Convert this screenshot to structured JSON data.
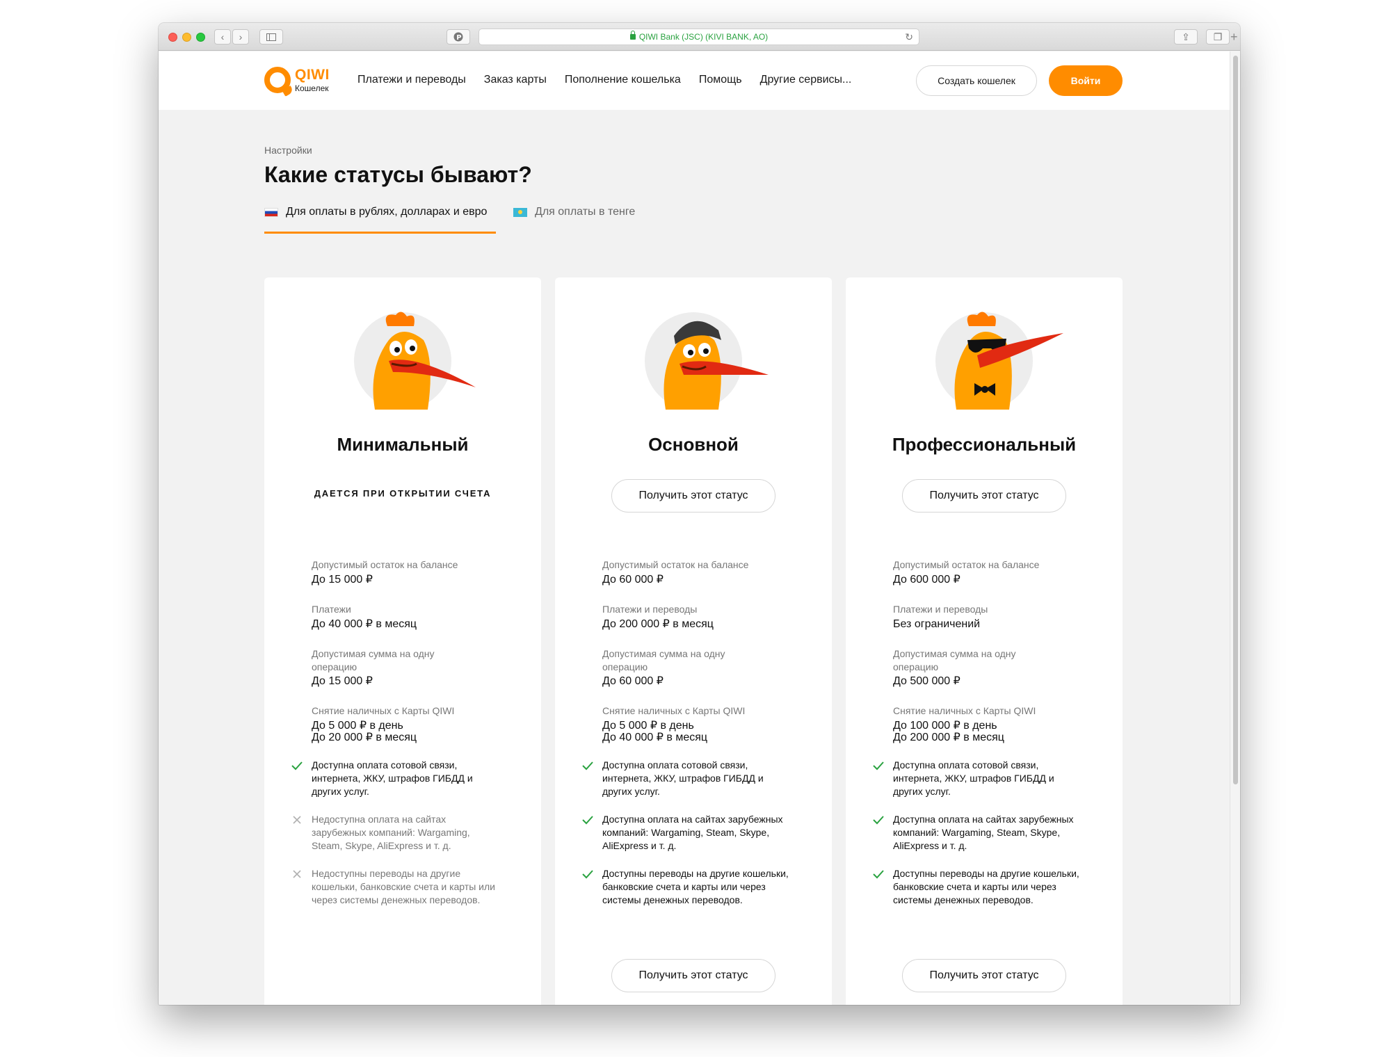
{
  "browser": {
    "address": "QIWI Bank (JSC) (KIVI BANK, AO)"
  },
  "header": {
    "brand": "QIWI",
    "brand_sub": "Кошелек",
    "nav": [
      "Платежи и переводы",
      "Заказ карты",
      "Пополнение кошелька",
      "Помощь",
      "Другие сервисы..."
    ],
    "create_wallet": "Создать кошелек",
    "login": "Войти"
  },
  "page": {
    "breadcrumb": "Настройки",
    "title": "Какие статусы бывают?",
    "tabs": [
      {
        "label": "Для оплаты в рублях, долларах и евро",
        "flag": "ru-flag-icon",
        "active": true
      },
      {
        "label": "Для оплаты в тенге",
        "flag": "kz-flag-icon",
        "active": false
      }
    ]
  },
  "colors": {
    "accent": "#ff8c00",
    "check": "#2aa240",
    "cross": "#b0b0b0"
  },
  "cards": [
    {
      "title": "Минимальный",
      "note": "ДАЕТСЯ ПРИ ОТКРЫТИИ СЧЕТА",
      "limits": [
        {
          "label": "Допустимый остаток на балансе",
          "value": "До 15 000 ₽"
        },
        {
          "label": "Платежи",
          "value": "До 40 000 ₽ в месяц"
        },
        {
          "label": "Допустимая сумма на одну операцию",
          "value": "До 15 000 ₽"
        },
        {
          "label": "Снятие наличных с Карты QIWI",
          "value": "До 5 000 ₽ в день\nДо 20 000 ₽ в месяц"
        }
      ],
      "features": [
        {
          "text": "Доступна оплата сотовой связи, интернета, ЖКУ, штрафов ГИБДД и других услуг.",
          "available": true
        },
        {
          "text": "Недоступна оплата на сайтах зарубежных компаний: Wargaming, Steam, Skype, AliExpress и т. д.",
          "available": false
        },
        {
          "text": "Недоступны переводы на другие кошельки, банковские счета и карты или через системы денежных переводов.",
          "available": false
        }
      ]
    },
    {
      "title": "Основной",
      "button": "Получить этот статус",
      "limits": [
        {
          "label": "Допустимый остаток на балансе",
          "value": "До 60 000 ₽"
        },
        {
          "label": "Платежи и переводы",
          "value": "До 200 000 ₽ в месяц"
        },
        {
          "label": "Допустимая сумма на одну операцию",
          "value": "До 60 000 ₽"
        },
        {
          "label": "Снятие наличных с Карты QIWI",
          "value": "До 5 000 ₽ в день\nДо 40 000 ₽ в месяц"
        }
      ],
      "features": [
        {
          "text": "Доступна оплата сотовой связи, интернета, ЖКУ, штрафов ГИБДД и других услуг.",
          "available": true
        },
        {
          "text": "Доступна оплата на сайтах зарубежных компаний: Wargaming, Steam, Skype, AliExpress и т. д.",
          "available": true
        },
        {
          "text": "Доступны переводы на другие кошельки, банковские счета и карты или через системы денежных переводов.",
          "available": true
        }
      ]
    },
    {
      "title": "Профессиональный",
      "button": "Получить этот статус",
      "limits": [
        {
          "label": "Допустимый остаток на балансе",
          "value": "До 600 000 ₽"
        },
        {
          "label": "Платежи и переводы",
          "value": "Без ограничений"
        },
        {
          "label": "Допустимая сумма на одну операцию",
          "value": "До 500 000 ₽"
        },
        {
          "label": "Снятие наличных с Карты QIWI",
          "value": "До 100 000 ₽ в день\nДо 200 000 ₽ в месяц"
        }
      ],
      "features": [
        {
          "text": "Доступна оплата сотовой связи, интернета, ЖКУ, штрафов ГИБДД и других услуг.",
          "available": true
        },
        {
          "text": "Доступна оплата на сайтах зарубежных компаний: Wargaming, Steam, Skype, AliExpress и т. д.",
          "available": true
        },
        {
          "text": "Доступны переводы на другие кошельки, банковские счета и карты или через системы денежных переводов.",
          "available": true
        }
      ]
    }
  ]
}
